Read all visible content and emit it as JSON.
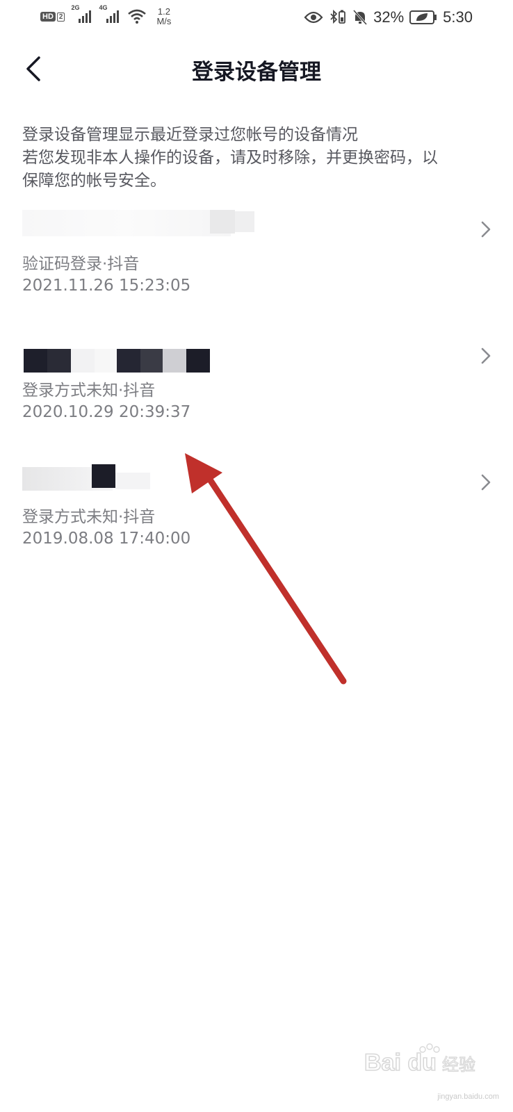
{
  "status_bar": {
    "hd_label": "HD",
    "sim_label": "2",
    "sig1_gen": "2G",
    "sig2_gen": "4G",
    "speed_value": "1.2",
    "speed_unit": "M/s",
    "battery_percent": "32%",
    "time": "5:30"
  },
  "nav": {
    "title": "登录设备管理"
  },
  "description": {
    "line1": "登录设备管理显示最近登录过您帐号的设备情况",
    "line2": "若您发现非本人操作的设备，请及时移除，并更换密码，以",
    "line3": "保障您的帐号安全。"
  },
  "devices": [
    {
      "meta": "验证码登录·抖音",
      "time": "2021.11.26 15:23:05"
    },
    {
      "meta": "登录方式未知·抖音",
      "time": "2020.10.29 20:39:37"
    },
    {
      "meta": "登录方式未知·抖音",
      "time": "2019.08.08 17:40:00"
    }
  ],
  "colors": {
    "accent_annotation": "#c0302b",
    "title_text": "#161823",
    "secondary_text": "#7c7d82"
  },
  "watermark": {
    "brand": "Bai du 经验",
    "url": "jingyan.baidu.com"
  }
}
